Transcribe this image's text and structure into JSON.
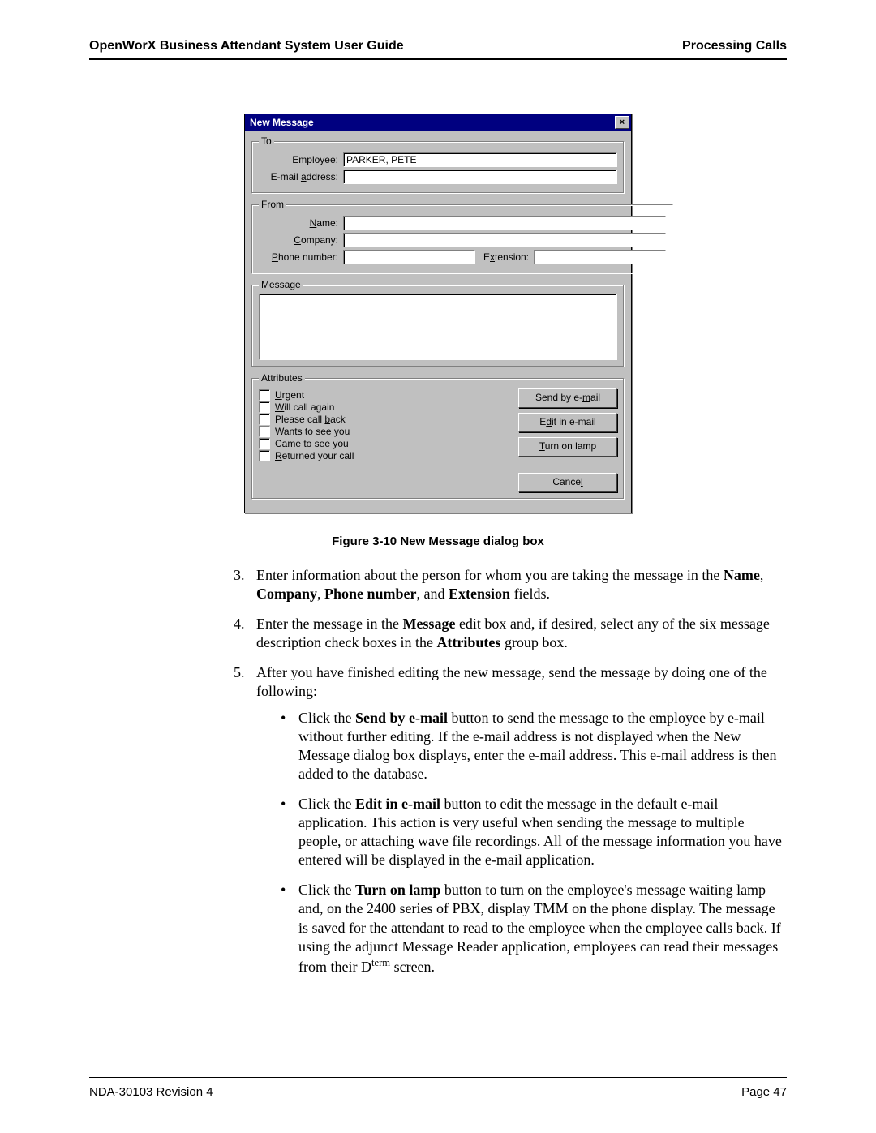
{
  "header": {
    "left": "OpenWorX Business Attendant System User Guide",
    "right": "Processing Calls"
  },
  "dialog": {
    "title": "New Message",
    "to_legend": "To",
    "from_legend": "From",
    "msg_legend": "Message",
    "attr_legend": "Attributes",
    "labels": {
      "employee": "Employee:",
      "email": "E-mail address:",
      "name": "Name:",
      "company": "Company:",
      "phone": "Phone number:",
      "ext": "Extension:"
    },
    "values": {
      "employee": "PARKER, PETE"
    },
    "checks": [
      "Urgent",
      "Will call again",
      "Please call back",
      "Wants to see you",
      "Came to see you",
      "Returned your call"
    ],
    "buttons": {
      "send": "Send by e-mail",
      "edit": "Edit in e-mail",
      "lamp": "Turn on lamp",
      "cancel": "Cancel"
    }
  },
  "caption": "Figure 3-10   New Message dialog box",
  "steps": {
    "s3a": "Enter information about the person for whom you are taking the message in the ",
    "s3b": "Name",
    "s3c": ", ",
    "s3d": "Company",
    "s3e": ", ",
    "s3f": "Phone number",
    "s3g": ", and ",
    "s3h": "Extension",
    "s3i": " fields.",
    "s4a": "Enter the message in the ",
    "s4b": "Message",
    "s4c": " edit box and, if desired, select any of the six message description check boxes in the ",
    "s4d": "Attributes",
    "s4e": " group box.",
    "s5": "After you have finished editing the new message, send the message by doing one of the following:"
  },
  "bullets": {
    "b1a": "Click the ",
    "b1b": "Send by e-mail",
    "b1c": " button to send the message to the employee by e-mail without further editing. If the e-mail address is not displayed when the New Message dialog box displays, enter the e-mail address. This e-mail address is then added to the database.",
    "b2a": "Click the ",
    "b2b": "Edit in e-mail",
    "b2c": " button to edit the message in the default e-mail application. This action is very useful when sending the message to multiple people, or attaching wave file recordings. All of the message information you have entered will be displayed in the e-mail application.",
    "b3a": "Click the ",
    "b3b": "Turn on lamp",
    "b3c": " button to turn on the employee's message waiting lamp and, on the 2400 series of PBX, display TMM on the phone display. The message is saved for the attendant to read to the employee when the employee calls back. If using the adjunct Message Reader application, employees can read their messages from their D",
    "b3d": "term",
    "b3e": " screen."
  },
  "footer": {
    "left": "NDA-30103  Revision 4",
    "right": "Page 47"
  }
}
